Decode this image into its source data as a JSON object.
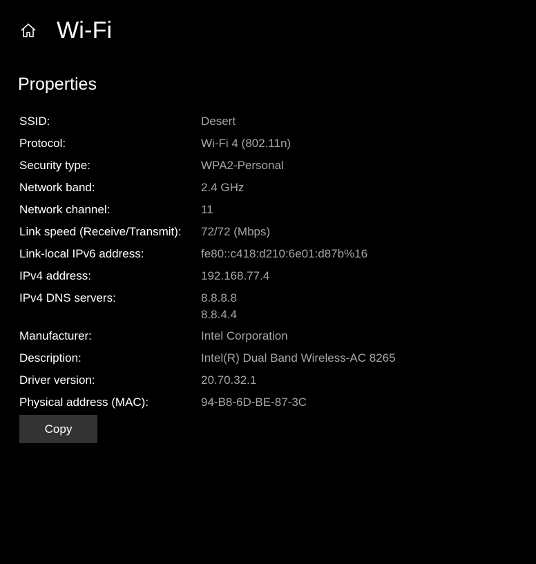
{
  "header": {
    "icon": "home-icon",
    "title": "Wi-Fi"
  },
  "section": {
    "title": "Properties"
  },
  "properties": [
    {
      "label": "SSID:",
      "values": [
        "Desert"
      ]
    },
    {
      "label": "Protocol:",
      "values": [
        "Wi-Fi 4 (802.11n)"
      ]
    },
    {
      "label": "Security type:",
      "values": [
        "WPA2-Personal"
      ]
    },
    {
      "label": "Network band:",
      "values": [
        "2.4 GHz"
      ]
    },
    {
      "label": "Network channel:",
      "values": [
        "11"
      ]
    },
    {
      "label": "Link speed (Receive/Transmit):",
      "values": [
        "72/72 (Mbps)"
      ]
    },
    {
      "label": "Link-local IPv6 address:",
      "values": [
        "fe80::c418:d210:6e01:d87b%16"
      ]
    },
    {
      "label": "IPv4 address:",
      "values": [
        "192.168.77.4"
      ]
    },
    {
      "label": "IPv4 DNS servers:",
      "values": [
        "8.8.8.8",
        "8.8.4.4"
      ]
    },
    {
      "label": "Manufacturer:",
      "values": [
        "Intel Corporation"
      ]
    },
    {
      "label": "Description:",
      "values": [
        "Intel(R) Dual Band Wireless-AC 8265"
      ]
    },
    {
      "label": "Driver version:",
      "values": [
        "20.70.32.1"
      ]
    },
    {
      "label": "Physical address (MAC):",
      "values": [
        "94-B8-6D-BE-87-3C"
      ]
    }
  ],
  "actions": {
    "copy_label": "Copy"
  },
  "colors": {
    "background": "#000000",
    "text": "#ffffff",
    "value_text": "#a6a6a6",
    "button_bg": "#333333"
  }
}
